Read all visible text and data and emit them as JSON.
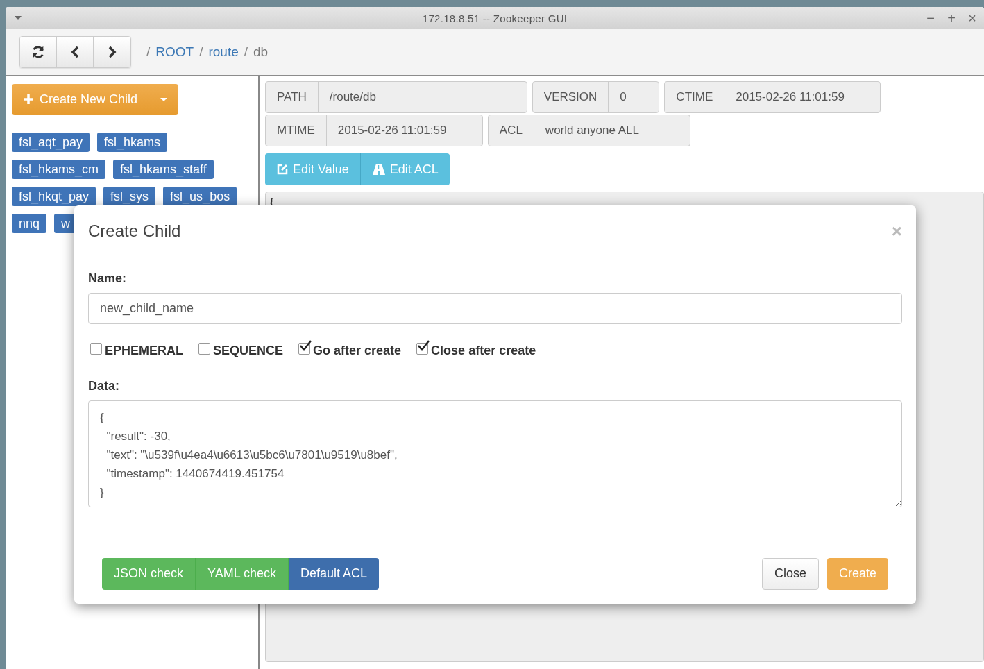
{
  "window": {
    "title": "172.18.8.51 -- Zookeeper GUI",
    "controls": [
      "−",
      "+",
      "×"
    ]
  },
  "breadcrumb": [
    {
      "separator": "/",
      "label": "ROOT",
      "link": true
    },
    {
      "separator": "/",
      "label": "route",
      "link": true
    },
    {
      "separator": "/",
      "label": "db",
      "link": false
    }
  ],
  "sidebar": {
    "create_button": "Create New Child",
    "tags": [
      "fsl_aqt_pay",
      "fsl_hkams",
      "fsl_hkams_cm",
      "fsl_hkams_staff",
      "fsl_hkqt_pay",
      "fsl_sys",
      "fsl_us_bos",
      "nnq",
      "w"
    ]
  },
  "details": {
    "rows": [
      [
        {
          "label": "PATH",
          "value": "/route/db"
        },
        {
          "label": "VERSION",
          "value": "0"
        },
        {
          "label": "CTIME",
          "value": "2015-02-26 11:01:59"
        }
      ],
      [
        {
          "label": "MTIME",
          "value": "2015-02-26 11:01:59"
        },
        {
          "label": "ACL",
          "value": "world anyone ALL"
        }
      ]
    ],
    "edit_buttons": [
      "Edit Value",
      "Edit ACL"
    ],
    "value_preview": "{"
  },
  "dialog": {
    "title": "Create Child",
    "close": "×",
    "name_label": "Name:",
    "name_value": "new_child_name",
    "options": [
      {
        "label": "EPHEMERAL",
        "checked": false
      },
      {
        "label": "SEQUENCE",
        "checked": false
      },
      {
        "label": "Go after create",
        "checked": true
      },
      {
        "label": "Close after create",
        "checked": true
      }
    ],
    "data_label": "Data:",
    "data": "{\n  \"result\": -30,\n  \"text\": \"\\u539f\\u4ea4\\u6613\\u5bc6\\u7801\\u9519\\u8bef\",\n  \"timestamp\": 1440674419.451754\n}",
    "left_buttons": [
      {
        "label": "JSON check",
        "kind": "success"
      },
      {
        "label": "YAML check",
        "kind": "success"
      },
      {
        "label": "Default ACL",
        "kind": "primary"
      }
    ],
    "right_buttons": [
      {
        "label": "Close",
        "kind": "default"
      },
      {
        "label": "Create",
        "kind": "warning"
      }
    ]
  }
}
